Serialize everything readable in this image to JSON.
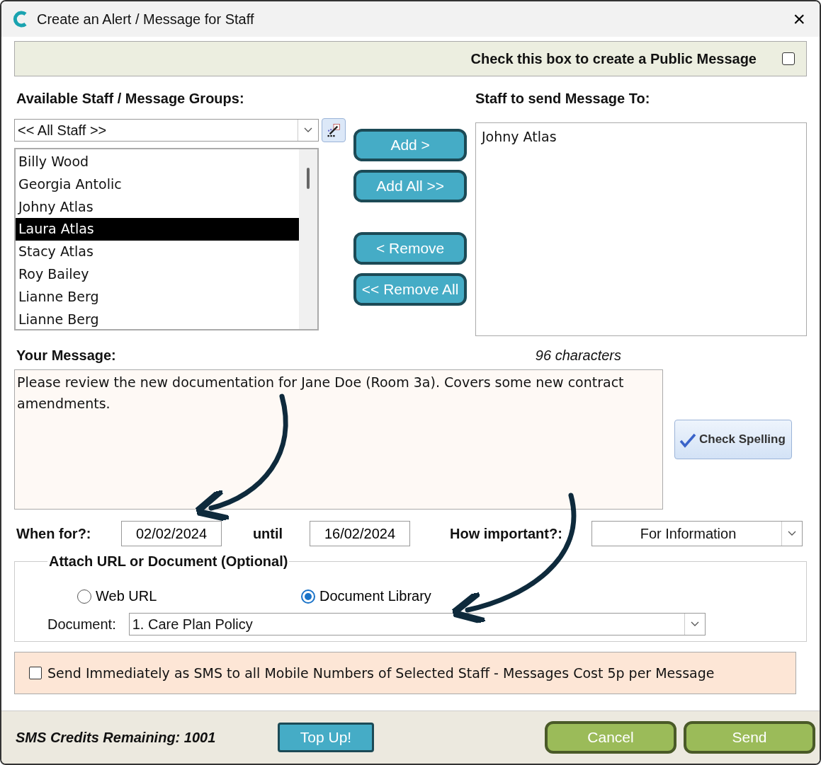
{
  "window": {
    "title": "Create an Alert / Message for Staff",
    "close": "×"
  },
  "public_message": {
    "label": "Check this box to create a Public Message",
    "checked": false
  },
  "available": {
    "label": "Available Staff / Message Groups:",
    "filter": "<< All Staff >>",
    "items": [
      {
        "name": "Billy Wood",
        "selected": false
      },
      {
        "name": "Georgia Antolic",
        "selected": false
      },
      {
        "name": "Johny Atlas",
        "selected": false
      },
      {
        "name": "Laura Atlas",
        "selected": true
      },
      {
        "name": "Stacy Atlas",
        "selected": false
      },
      {
        "name": "Roy Bailey",
        "selected": false
      },
      {
        "name": "Lianne Berg",
        "selected": false
      },
      {
        "name": "Lianne Berg",
        "selected": false
      }
    ]
  },
  "move_buttons": [
    "Add >",
    "Add All >>",
    "< Remove",
    "<< Remove All"
  ],
  "recipients": {
    "label": "Staff to send Message To:",
    "items": [
      "Johny Atlas"
    ]
  },
  "message": {
    "label": "Your Message:",
    "count": "96 characters",
    "value": "Please review the new documentation for Jane Doe (Room 3a). Covers some new contract amendments.",
    "spell_button": "Check Spelling"
  },
  "when": {
    "label": "When for?:",
    "from": "02/02/2024",
    "until_label": "until",
    "until": "16/02/2024",
    "importance_label": "How important?:",
    "importance": "For Information"
  },
  "attach": {
    "label": "Attach URL or Document (Optional)",
    "options": [
      {
        "label": "Web URL",
        "selected": false
      },
      {
        "label": "Document Library",
        "selected": true
      }
    ],
    "document_label": "Document:",
    "document": "1. Care Plan Policy"
  },
  "sms": {
    "label": "Send Immediately as SMS to all Mobile Numbers of Selected Staff - Messages Cost 5p per Message",
    "checked": false
  },
  "footer": {
    "credits": "SMS Credits Remaining: 1001",
    "top_up": "Top Up!",
    "cancel": "Cancel",
    "send": "Send"
  }
}
